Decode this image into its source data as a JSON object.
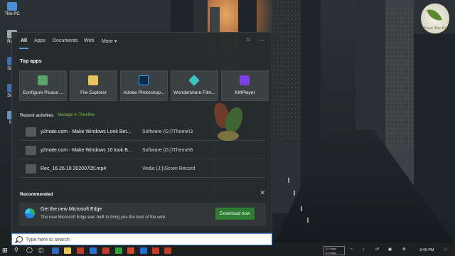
{
  "desktop": {
    "icons": [
      {
        "label": "This PC"
      },
      {
        "label": "Recy"
      },
      {
        "label": "Simp"
      },
      {
        "label": "Simp"
      },
      {
        "label": "Ne"
      }
    ],
    "watermark_text": "Trust The Dy"
  },
  "panel": {
    "tabs": [
      {
        "label": "All",
        "active": true
      },
      {
        "label": "Apps"
      },
      {
        "label": "Documents"
      },
      {
        "label": "Web"
      },
      {
        "label": "More"
      }
    ],
    "header_icons": [
      "feedback-icon",
      "more-options-icon"
    ],
    "top_apps": {
      "title": "Top apps",
      "items": [
        {
          "label": "Configure Picasa ...",
          "icon": "picasa-icon",
          "color": "#5aa469"
        },
        {
          "label": "File Explorer",
          "icon": "folder-icon",
          "color": "#e8c45a"
        },
        {
          "label": "Adobe Photoshop...",
          "icon": "photoshop-icon",
          "color": "#0b2a4a"
        },
        {
          "label": "Wondershare Film...",
          "icon": "filmora-icon",
          "color": "#3cc4c4"
        },
        {
          "label": "KMPlayer",
          "icon": "kmplayer-icon",
          "color": "#7b3fe4"
        }
      ]
    },
    "recent": {
      "title": "Recent activities",
      "link": "Manage in Timeline",
      "items": [
        {
          "name": "y2mate.com - Make Windows Look Bet...",
          "location": "Software (G:)\\Theme\\3"
        },
        {
          "name": "y2mate.com - Make Windows 10 look B...",
          "location": "Software (G:)\\Theme\\8"
        },
        {
          "name": "Rec_16.26.10 20200705.mp4",
          "location": "Vedio (J:)\\Scren Record"
        }
      ]
    },
    "recommended": {
      "title": "Recommended",
      "card_title": "Get the new Microsoft Edge",
      "card_subtitle": "The new Microsoft Edge was built to bring you the best of the web.",
      "button": "Download now"
    }
  },
  "search": {
    "placeholder": "Type here to search"
  },
  "taskbar": {
    "net_up": "0.0 kbps",
    "net_down": "0.0 kbps",
    "time": "3:46 PM",
    "pinned_colors": [
      "#2d6cc0",
      "#e8c45a",
      "#c23b2b",
      "#7b3fe4",
      "#c23b2b",
      "#2aa53d",
      "#d04b2c",
      "#1e6fd9",
      "#c23b2b"
    ]
  }
}
